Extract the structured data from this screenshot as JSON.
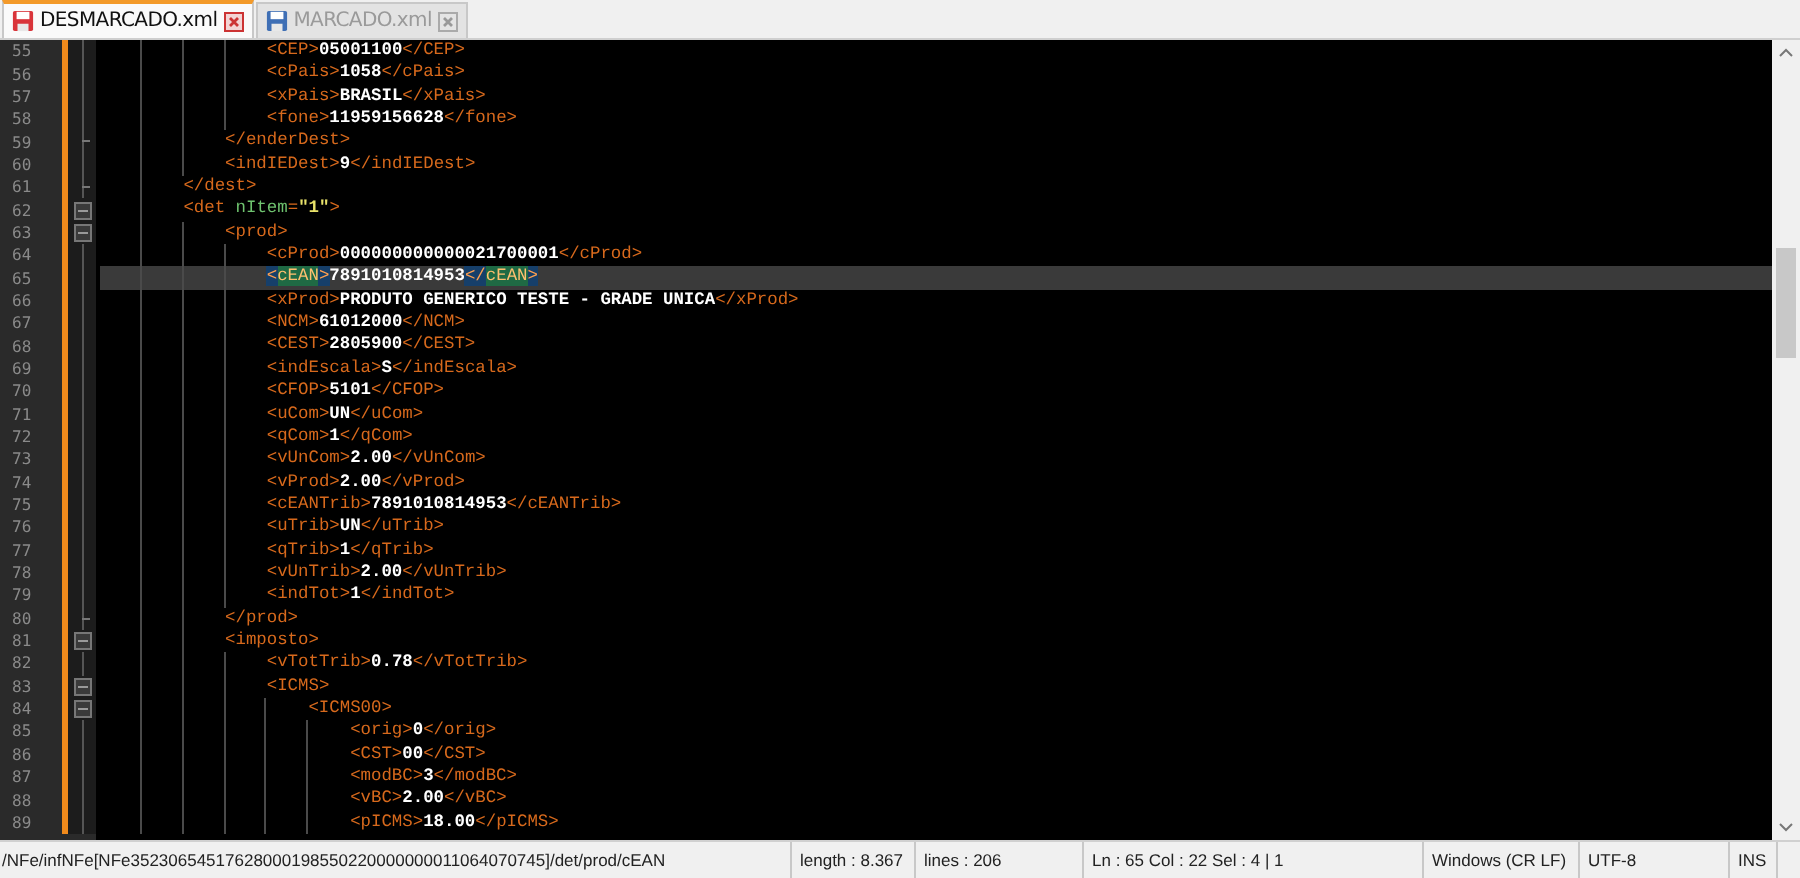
{
  "tabs": [
    {
      "label": "DESMARCADO.xml",
      "selected": true
    },
    {
      "label": "MARCADO.xml",
      "selected": false
    }
  ],
  "editor": {
    "lines": [
      {
        "number": "55",
        "selected": false,
        "tokens": [
          {
            "kind": "tag",
            "t": "                <CEP>"
          },
          {
            "kind": "text",
            "t": "05001100"
          },
          {
            "kind": "tag",
            "t": "</CEP>"
          }
        ]
      },
      {
        "number": "56",
        "selected": false,
        "tokens": [
          {
            "kind": "tag",
            "t": "                <cPais>"
          },
          {
            "kind": "text",
            "t": "1058"
          },
          {
            "kind": "tag",
            "t": "</cPais>"
          }
        ]
      },
      {
        "number": "57",
        "selected": false,
        "tokens": [
          {
            "kind": "tag",
            "t": "                <xPais>"
          },
          {
            "kind": "text",
            "t": "BRASIL"
          },
          {
            "kind": "tag",
            "t": "</xPais>"
          }
        ]
      },
      {
        "number": "58",
        "selected": false,
        "tokens": [
          {
            "kind": "tag",
            "t": "                <fone>"
          },
          {
            "kind": "text",
            "t": "11959156628"
          },
          {
            "kind": "tag",
            "t": "</fone>"
          }
        ]
      },
      {
        "number": "59",
        "selected": false,
        "kind": "fold_end",
        "tokens": [
          {
            "kind": "tag",
            "t": "            </enderDest>"
          }
        ]
      },
      {
        "number": "60",
        "selected": false,
        "tokens": [
          {
            "kind": "tag",
            "t": "            <indIEDest>"
          },
          {
            "kind": "text",
            "t": "9"
          },
          {
            "kind": "tag",
            "t": "</indIEDest>"
          }
        ]
      },
      {
        "number": "61",
        "selected": false,
        "kind": "fold_end",
        "tokens": [
          {
            "kind": "tag",
            "t": "        </dest>"
          }
        ]
      },
      {
        "number": "62",
        "selected": false,
        "kind": "fold_start",
        "tokens": [
          {
            "kind": "tag",
            "t": "        <det "
          },
          {
            "kind": "attr",
            "t": "nItem"
          },
          {
            "kind": "tag",
            "t": "="
          },
          {
            "kind": "string",
            "t": "\"1\""
          },
          {
            "kind": "tag",
            "t": ">"
          }
        ]
      },
      {
        "number": "63",
        "selected": false,
        "kind": "fold_start",
        "tokens": [
          {
            "kind": "tag",
            "t": "            <prod>"
          }
        ]
      },
      {
        "number": "64",
        "selected": false,
        "tokens": [
          {
            "kind": "tag",
            "t": "                <cProd>"
          },
          {
            "kind": "text",
            "t": "000000000000021700001"
          },
          {
            "kind": "tag",
            "t": "</cProd>"
          }
        ]
      },
      {
        "number": "65",
        "selected": true,
        "tokens": [
          {
            "kind": "brace",
            "t": "                <"
          },
          {
            "kind": "match",
            "t": "cEAN"
          },
          {
            "kind": "brace",
            "t": ">"
          },
          {
            "kind": "text",
            "t": "7891010814953"
          },
          {
            "kind": "brace",
            "t": "</"
          },
          {
            "kind": "match",
            "t": "cEAN"
          },
          {
            "kind": "brace",
            "t": ">"
          }
        ]
      },
      {
        "number": "66",
        "selected": false,
        "tokens": [
          {
            "kind": "tag",
            "t": "                <xProd>"
          },
          {
            "kind": "text",
            "t": "PRODUTO GENERICO TESTE - GRADE UNICA"
          },
          {
            "kind": "tag",
            "t": "</xProd>"
          }
        ]
      },
      {
        "number": "67",
        "selected": false,
        "tokens": [
          {
            "kind": "tag",
            "t": "                <NCM>"
          },
          {
            "kind": "text",
            "t": "61012000"
          },
          {
            "kind": "tag",
            "t": "</NCM>"
          }
        ]
      },
      {
        "number": "68",
        "selected": false,
        "tokens": [
          {
            "kind": "tag",
            "t": "                <CEST>"
          },
          {
            "kind": "text",
            "t": "2805900"
          },
          {
            "kind": "tag",
            "t": "</CEST>"
          }
        ]
      },
      {
        "number": "69",
        "selected": false,
        "tokens": [
          {
            "kind": "tag",
            "t": "                <indEscala>"
          },
          {
            "kind": "text",
            "t": "S"
          },
          {
            "kind": "tag",
            "t": "</indEscala>"
          }
        ]
      },
      {
        "number": "70",
        "selected": false,
        "tokens": [
          {
            "kind": "tag",
            "t": "                <CFOP>"
          },
          {
            "kind": "text",
            "t": "5101"
          },
          {
            "kind": "tag",
            "t": "</CFOP>"
          }
        ]
      },
      {
        "number": "71",
        "selected": false,
        "tokens": [
          {
            "kind": "tag",
            "t": "                <uCom>"
          },
          {
            "kind": "text",
            "t": "UN"
          },
          {
            "kind": "tag",
            "t": "</uCom>"
          }
        ]
      },
      {
        "number": "72",
        "selected": false,
        "tokens": [
          {
            "kind": "tag",
            "t": "                <qCom>"
          },
          {
            "kind": "text",
            "t": "1"
          },
          {
            "kind": "tag",
            "t": "</qCom>"
          }
        ]
      },
      {
        "number": "73",
        "selected": false,
        "tokens": [
          {
            "kind": "tag",
            "t": "                <vUnCom>"
          },
          {
            "kind": "text",
            "t": "2.00"
          },
          {
            "kind": "tag",
            "t": "</vUnCom>"
          }
        ]
      },
      {
        "number": "74",
        "selected": false,
        "tokens": [
          {
            "kind": "tag",
            "t": "                <vProd>"
          },
          {
            "kind": "text",
            "t": "2.00"
          },
          {
            "kind": "tag",
            "t": "</vProd>"
          }
        ]
      },
      {
        "number": "75",
        "selected": false,
        "tokens": [
          {
            "kind": "tag",
            "t": "                <cEANTrib>"
          },
          {
            "kind": "text",
            "t": "7891010814953"
          },
          {
            "kind": "tag",
            "t": "</cEANTrib>"
          }
        ]
      },
      {
        "number": "76",
        "selected": false,
        "tokens": [
          {
            "kind": "tag",
            "t": "                <uTrib>"
          },
          {
            "kind": "text",
            "t": "UN"
          },
          {
            "kind": "tag",
            "t": "</uTrib>"
          }
        ]
      },
      {
        "number": "77",
        "selected": false,
        "tokens": [
          {
            "kind": "tag",
            "t": "                <qTrib>"
          },
          {
            "kind": "text",
            "t": "1"
          },
          {
            "kind": "tag",
            "t": "</qTrib>"
          }
        ]
      },
      {
        "number": "78",
        "selected": false,
        "tokens": [
          {
            "kind": "tag",
            "t": "                <vUnTrib>"
          },
          {
            "kind": "text",
            "t": "2.00"
          },
          {
            "kind": "tag",
            "t": "</vUnTrib>"
          }
        ]
      },
      {
        "number": "79",
        "selected": false,
        "tokens": [
          {
            "kind": "tag",
            "t": "                <indTot>"
          },
          {
            "kind": "text",
            "t": "1"
          },
          {
            "kind": "tag",
            "t": "</indTot>"
          }
        ]
      },
      {
        "number": "80",
        "selected": false,
        "kind": "fold_end",
        "tokens": [
          {
            "kind": "tag",
            "t": "            </prod>"
          }
        ]
      },
      {
        "number": "81",
        "selected": false,
        "kind": "fold_start",
        "tokens": [
          {
            "kind": "tag",
            "t": "            <imposto>"
          }
        ]
      },
      {
        "number": "82",
        "selected": false,
        "tokens": [
          {
            "kind": "tag",
            "t": "                <vTotTrib>"
          },
          {
            "kind": "text",
            "t": "0.78"
          },
          {
            "kind": "tag",
            "t": "</vTotTrib>"
          }
        ]
      },
      {
        "number": "83",
        "selected": false,
        "kind": "fold_start",
        "tokens": [
          {
            "kind": "tag",
            "t": "                <ICMS>"
          }
        ]
      },
      {
        "number": "84",
        "selected": false,
        "kind": "fold_start",
        "tokens": [
          {
            "kind": "tag",
            "t": "                    <ICMS00>"
          }
        ]
      },
      {
        "number": "85",
        "selected": false,
        "tokens": [
          {
            "kind": "tag",
            "t": "                        <orig>"
          },
          {
            "kind": "text",
            "t": "0"
          },
          {
            "kind": "tag",
            "t": "</orig>"
          }
        ]
      },
      {
        "number": "86",
        "selected": false,
        "tokens": [
          {
            "kind": "tag",
            "t": "                        <CST>"
          },
          {
            "kind": "text",
            "t": "00"
          },
          {
            "kind": "tag",
            "t": "</CST>"
          }
        ]
      },
      {
        "number": "87",
        "selected": false,
        "tokens": [
          {
            "kind": "tag",
            "t": "                        <modBC>"
          },
          {
            "kind": "text",
            "t": "3"
          },
          {
            "kind": "tag",
            "t": "</modBC>"
          }
        ]
      },
      {
        "number": "88",
        "selected": false,
        "tokens": [
          {
            "kind": "tag",
            "t": "                        <vBC>"
          },
          {
            "kind": "text",
            "t": "2.00"
          },
          {
            "kind": "tag",
            "t": "</vBC>"
          }
        ]
      },
      {
        "number": "89",
        "selected": false,
        "tokens": [
          {
            "kind": "tag",
            "t": "                        <pICMS>"
          },
          {
            "kind": "text",
            "t": "18.00"
          },
          {
            "kind": "tag",
            "t": "</pICMS>"
          }
        ]
      }
    ]
  },
  "status_bar": {
    "path": "/NFe/infNFe[NFe35230654517628000198550220000000011064070745]/det/prod/cEAN",
    "length": "length : 8.367",
    "lines": "lines : 206",
    "position": "Ln : 65    Col : 22    Sel : 4 | 1",
    "eol": "Windows (CR LF)",
    "encoding": "UTF-8",
    "mode": "INS"
  }
}
